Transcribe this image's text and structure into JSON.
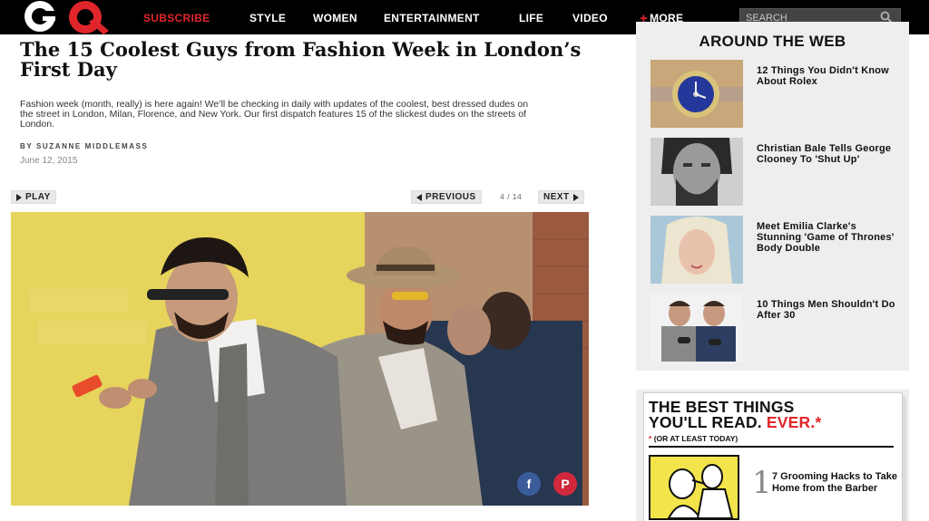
{
  "nav": {
    "logo": "GQ",
    "subscribe": "SUBSCRIBE",
    "items": [
      "STYLE",
      "WOMEN",
      "ENTERTAINMENT",
      "LIFE",
      "VIDEO"
    ],
    "more_plus": "+",
    "more": "MORE",
    "search_placeholder": "SEARCH"
  },
  "article": {
    "headline": "The 15 Coolest Guys from Fashion Week in London’s First Day",
    "dek": "Fashion week (month, really) is here again! We’ll be checking in daily with updates of the coolest, best dressed dudes on the street in London, Milan, Florence, and New York. Our first dispatch features 15 of the slickest dudes on the streets of London.",
    "byline": "BY SUZANNE MIDDLEMASS",
    "date": "June 12, 2015"
  },
  "gallery": {
    "play": "PLAY",
    "previous": "PREVIOUS",
    "counter": "4 / 14",
    "next": "NEXT",
    "share_facebook": "f",
    "share_pinterest": "P"
  },
  "sidebar": {
    "around_title": "AROUND THE WEB",
    "cards": [
      {
        "caption": "12 Things You Didn't Know About Rolex"
      },
      {
        "caption": "Christian Bale Tells George Clooney To 'Shut Up'"
      },
      {
        "caption": "Meet Emilia Clarke's Stunning 'Game of Thrones' Body Double"
      },
      {
        "caption": "10 Things Men Shouldn't Do After 30"
      }
    ],
    "best": {
      "line1": "THE BEST THINGS",
      "line2": "YOU'LL READ. ",
      "ever": "EVER.*",
      "star": "*",
      "sub": "(OR AT LEAST TODAY)",
      "num": "1",
      "item": "7 Grooming Hacks to Take Home from the Barber"
    }
  },
  "colors": {
    "accent": "#e0262b",
    "facebook": "#3b5c9a",
    "pinterest": "#d1283c",
    "photo_bg": "#e8d55a"
  }
}
